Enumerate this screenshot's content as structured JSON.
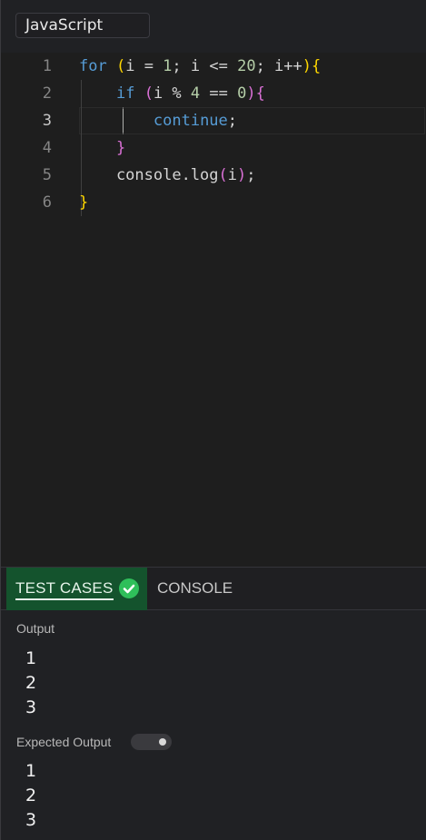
{
  "toolbar": {
    "language": "JavaScript"
  },
  "editor": {
    "active_line": 3,
    "lines": [
      {
        "number": "1",
        "text": "for (i = 1; i <= 20; i++){"
      },
      {
        "number": "2",
        "text": "    if (i % 4 == 0){"
      },
      {
        "number": "3",
        "text": "        continue;"
      },
      {
        "number": "4",
        "text": "    }"
      },
      {
        "number": "5",
        "text": "    console.log(i);"
      },
      {
        "number": "6",
        "text": "}"
      }
    ]
  },
  "panel": {
    "tabs": [
      {
        "label": "TEST CASES",
        "active": true,
        "status_icon": "check-circle-icon"
      },
      {
        "label": "CONSOLE",
        "active": false
      }
    ],
    "output_label": "Output",
    "output_values": [
      "1",
      "2",
      "3"
    ],
    "expected_label": "Expected Output",
    "expected_toggle_on": false,
    "expected_values": [
      "1",
      "2",
      "3"
    ]
  },
  "colors": {
    "active_tab_bg": "#14532d",
    "check_green": "#2fbf5a",
    "keyword": "#569cd6",
    "number": "#b5cea8",
    "bracket_level1": "#ffd700",
    "bracket_level2": "#da70d6"
  }
}
